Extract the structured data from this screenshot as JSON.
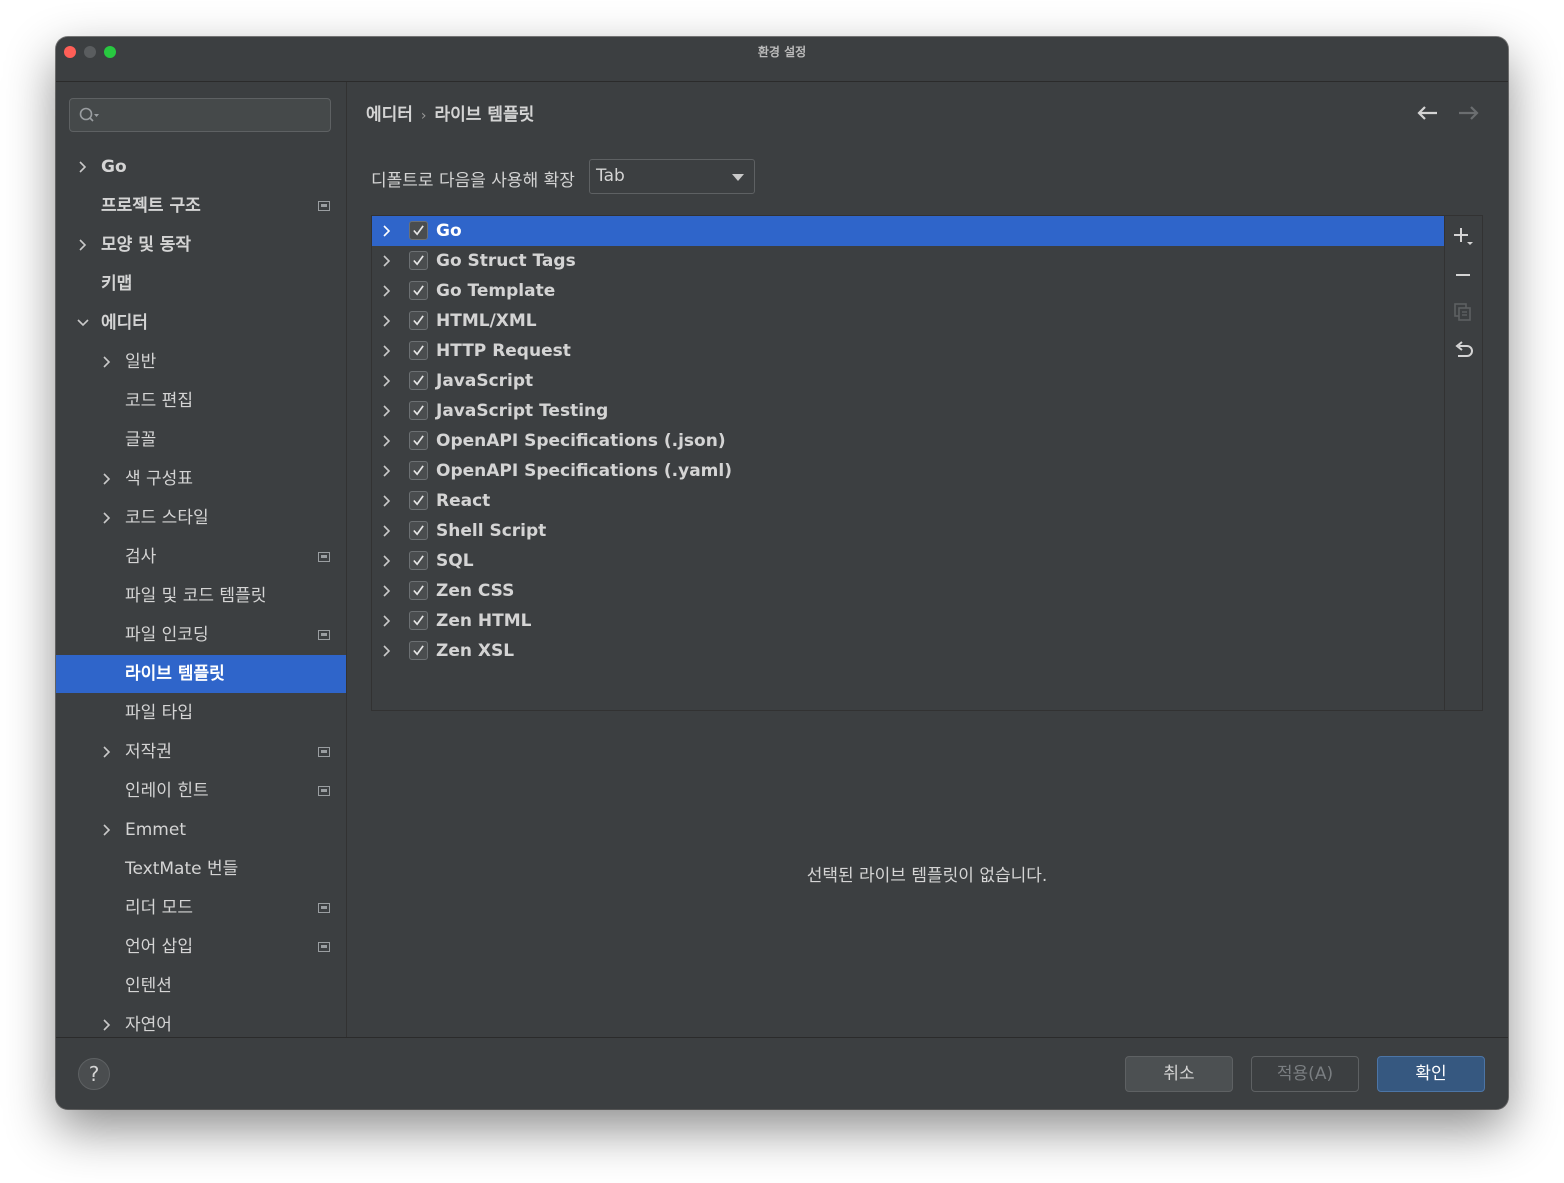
{
  "window": {
    "title": "환경 설정"
  },
  "sidebar": {
    "search_placeholder": "",
    "items": [
      {
        "label": "Go",
        "expandable": true,
        "level": 0
      },
      {
        "label": "프로젝트 구조",
        "expandable": false,
        "level": 0,
        "project_badge": true
      },
      {
        "label": "모양 및 동작",
        "expandable": true,
        "level": 0
      },
      {
        "label": "키맵",
        "expandable": false,
        "level": 0
      },
      {
        "label": "에디터",
        "expandable": true,
        "expanded": true,
        "level": 0
      },
      {
        "label": "일반",
        "expandable": true,
        "level": 1
      },
      {
        "label": "코드 편집",
        "expandable": false,
        "level": 1
      },
      {
        "label": "글꼴",
        "expandable": false,
        "level": 1
      },
      {
        "label": "색 구성표",
        "expandable": true,
        "level": 1
      },
      {
        "label": "코드 스타일",
        "expandable": true,
        "level": 1
      },
      {
        "label": "검사",
        "expandable": false,
        "level": 1,
        "project_badge": true
      },
      {
        "label": "파일 및 코드 템플릿",
        "expandable": false,
        "level": 1
      },
      {
        "label": "파일 인코딩",
        "expandable": false,
        "level": 1,
        "project_badge": true
      },
      {
        "label": "라이브 템플릿",
        "expandable": false,
        "level": 1,
        "selected": true
      },
      {
        "label": "파일 타입",
        "expandable": false,
        "level": 1
      },
      {
        "label": "저작권",
        "expandable": true,
        "level": 1,
        "project_badge": true
      },
      {
        "label": "인레이 힌트",
        "expandable": false,
        "level": 1,
        "project_badge": true
      },
      {
        "label": "Emmet",
        "expandable": true,
        "level": 1
      },
      {
        "label": "TextMate 번들",
        "expandable": false,
        "level": 1
      },
      {
        "label": "리더 모드",
        "expandable": false,
        "level": 1,
        "project_badge": true
      },
      {
        "label": "언어 삽입",
        "expandable": false,
        "level": 1,
        "project_badge": true
      },
      {
        "label": "인텐션",
        "expandable": false,
        "level": 1
      },
      {
        "label": "자연어",
        "expandable": true,
        "level": 1
      }
    ]
  },
  "breadcrumb": {
    "parent": "에디터",
    "separator": "›",
    "current": "라이브 템플릿"
  },
  "expand": {
    "label": "디폴트로 다음을 사용해 확장",
    "value": "Tab"
  },
  "templates": [
    {
      "name": "Go",
      "checked": true,
      "selected": true
    },
    {
      "name": "Go Struct Tags",
      "checked": true
    },
    {
      "name": "Go Template",
      "checked": true
    },
    {
      "name": "HTML/XML",
      "checked": true
    },
    {
      "name": "HTTP Request",
      "checked": true
    },
    {
      "name": "JavaScript",
      "checked": true
    },
    {
      "name": "JavaScript Testing",
      "checked": true
    },
    {
      "name": "OpenAPI Specifications (.json)",
      "checked": true
    },
    {
      "name": "OpenAPI Specifications (.yaml)",
      "checked": true
    },
    {
      "name": "React",
      "checked": true
    },
    {
      "name": "Shell Script",
      "checked": true
    },
    {
      "name": "SQL",
      "checked": true
    },
    {
      "name": "Zen CSS",
      "checked": true
    },
    {
      "name": "Zen HTML",
      "checked": true
    },
    {
      "name": "Zen XSL",
      "checked": true
    }
  ],
  "toolbar": {
    "icons": [
      "add-icon",
      "remove-icon",
      "copy-icon",
      "restore-icon"
    ]
  },
  "empty_message": "선택된 라이브 템플릿이 없습니다.",
  "footer": {
    "help": "?",
    "cancel": "취소",
    "apply": "적용(A)",
    "ok": "확인"
  },
  "colors": {
    "accent": "#2f65ca",
    "ok_button": "#365880",
    "background": "#3c3f41"
  }
}
